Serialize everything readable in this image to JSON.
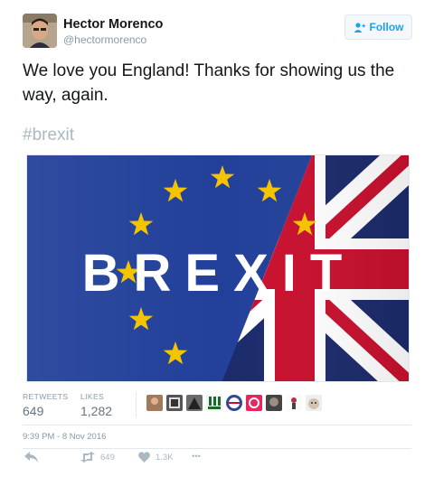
{
  "author": {
    "name": "Hector Morenco",
    "handle": "@hectormorenco"
  },
  "follow_button": {
    "label": "Follow",
    "icon": "add-user-icon"
  },
  "tweet": {
    "text": "We love you England! Thanks for showing us the way, again.",
    "hashtag": "#brexit"
  },
  "media": {
    "word": "BREXIT",
    "colors": {
      "eu_blue": "#1f3a8c",
      "star": "#f5c400",
      "union_red": "#c8102e",
      "union_blue": "#1b2a6b"
    }
  },
  "stats": {
    "retweets_label": "RETWEETS",
    "retweets_value": "649",
    "likes_label": "LIKES",
    "likes_value": "1,282"
  },
  "likers_count_shown": 10,
  "timestamp": "9:39 PM - 8 Nov 2016",
  "actions": {
    "reply_icon": "reply-icon",
    "retweet_icon": "retweet-icon",
    "retweet_count": "649",
    "like_icon": "heart-icon",
    "like_count": "1.3K",
    "more_icon": "more-icon",
    "more_label": "•••"
  },
  "colors": {
    "accent": "#1da1f2",
    "muted": "#8899a6",
    "text": "#14171a"
  }
}
